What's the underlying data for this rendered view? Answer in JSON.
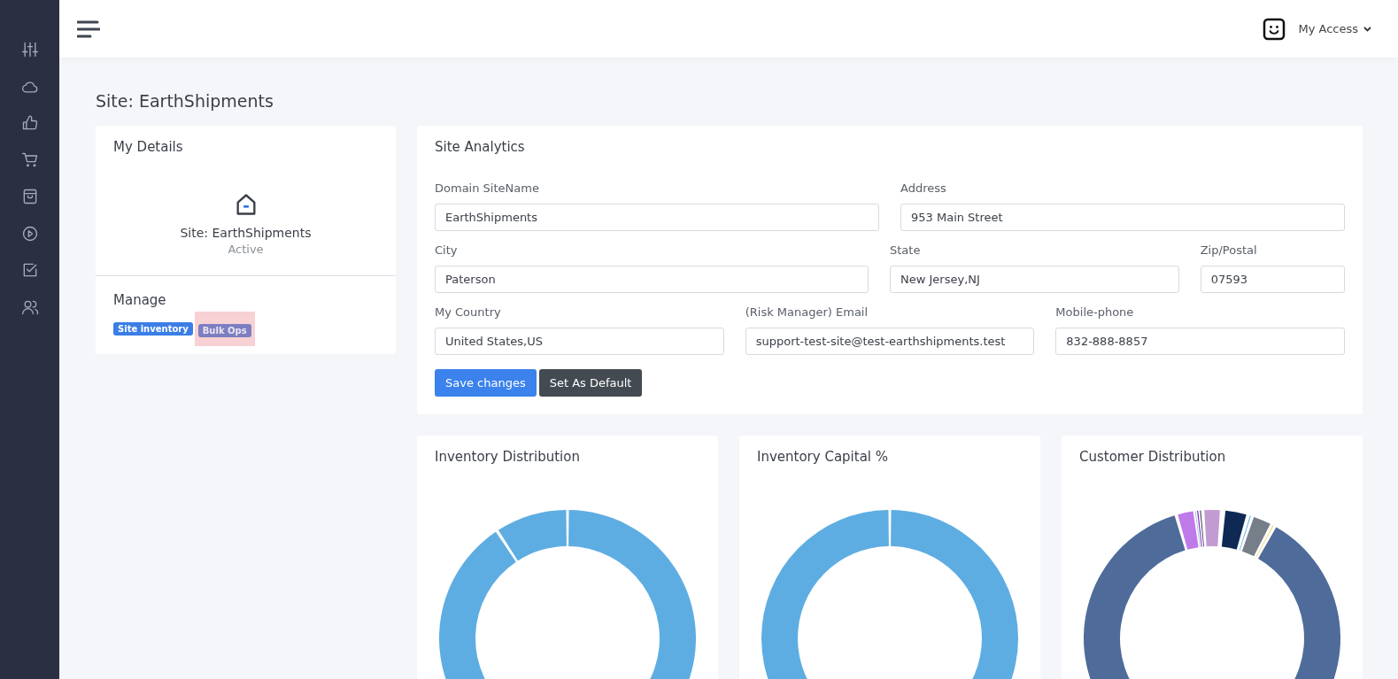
{
  "sidebar": {
    "items": [
      {
        "selected": false
      },
      {
        "selected": false
      },
      {
        "selected": false
      },
      {
        "selected": false
      },
      {
        "selected": false
      },
      {
        "selected": false
      },
      {
        "selected": false
      },
      {
        "selected": false
      }
    ]
  },
  "topbar": {
    "user_menu": "My Access"
  },
  "page_title": "Site: EarthShipments",
  "details_card": {
    "title": "My Details",
    "site_name": "Site: EarthShipments",
    "status": "Active",
    "manage_title": "Manage",
    "badges": [
      {
        "label": "Site inventory",
        "kind": "primary",
        "highlighted": false
      },
      {
        "label": "Bulk Ops",
        "kind": "secondary",
        "highlighted": true
      }
    ]
  },
  "analytics": {
    "title": "Site Analytics",
    "rows": [
      [
        {
          "label": "Domain SiteName",
          "value": "EarthShipments"
        },
        {
          "label": "Address",
          "value": "953 Main Street"
        }
      ],
      [
        {
          "label": "City",
          "value": "Paterson"
        },
        {
          "label": "State",
          "value": "New Jersey,NJ"
        },
        {
          "label": "Zip/Postal",
          "value": "07593"
        }
      ],
      [
        {
          "label": "My Country",
          "value": "United States,US"
        },
        {
          "label": "(Risk Manager) Email",
          "value": "support-test-site@test-earthshipments.test"
        },
        {
          "label": "Mobile-phone",
          "value": "832-888-8857"
        }
      ]
    ],
    "buttons": [
      {
        "label": "Save changes",
        "kind": "primary"
      },
      {
        "label": "Set As Default",
        "kind": "dark"
      }
    ]
  },
  "charts": [
    {
      "title": "Inventory Distribution"
    },
    {
      "title": "Inventory Capital %"
    },
    {
      "title": "Customer Distribution"
    }
  ]
}
